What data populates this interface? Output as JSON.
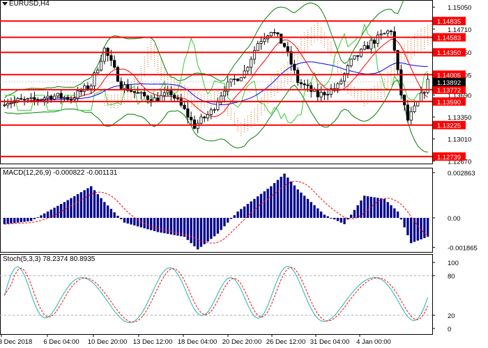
{
  "symbol_label": "EURUSD,H4",
  "macd_label": "MACD(12,26,9) -0.000822 -0.001131",
  "stoch_label": "Stoch(5,3,3) 78.2374 80.8935",
  "colors": {
    "level": "#ff0000",
    "candle": "#000000",
    "ma_blue": "#0000ff",
    "ma_red": "#ff0000",
    "band_green": "#008000",
    "rsi_lime": "#32cd32",
    "cloud": "#d2691e",
    "macd_hist": "#00008b",
    "macd_signal": "#ff0000",
    "stoch_main": "#20b2aa",
    "stoch_signal": "#ff0000",
    "current_price_bg": "#000000"
  },
  "price_axis": {
    "min": 1.2655,
    "max": 1.1515,
    "ticks": [
      "1.15050",
      "1.14710",
      "1.14350",
      "1.14005",
      "1.13690",
      "1.13350",
      "1.13010",
      "1.12670"
    ],
    "current_price": "1.13892"
  },
  "levels": [
    "1.14835",
    "1.14583",
    "1.14350",
    "1.14005",
    "1.13772",
    "1.13590",
    "1.13225",
    "1.12739"
  ],
  "macd_axis": {
    "ticks": [
      "0.002863",
      "0.00",
      "-0.001865"
    ]
  },
  "stoch_axis": {
    "ticks": [
      "100",
      "80",
      "20",
      "0"
    ]
  },
  "time_labels": [
    "3 Dec 2018",
    "6 Dec 04:00",
    "10 Dec 20:00",
    "13 Dec 12:00",
    "18 Dec 04:00",
    "20 Dec 20:00",
    "26 Dec 12:00",
    "31 Dec 04:00",
    "4 Jan 00:00"
  ]
}
